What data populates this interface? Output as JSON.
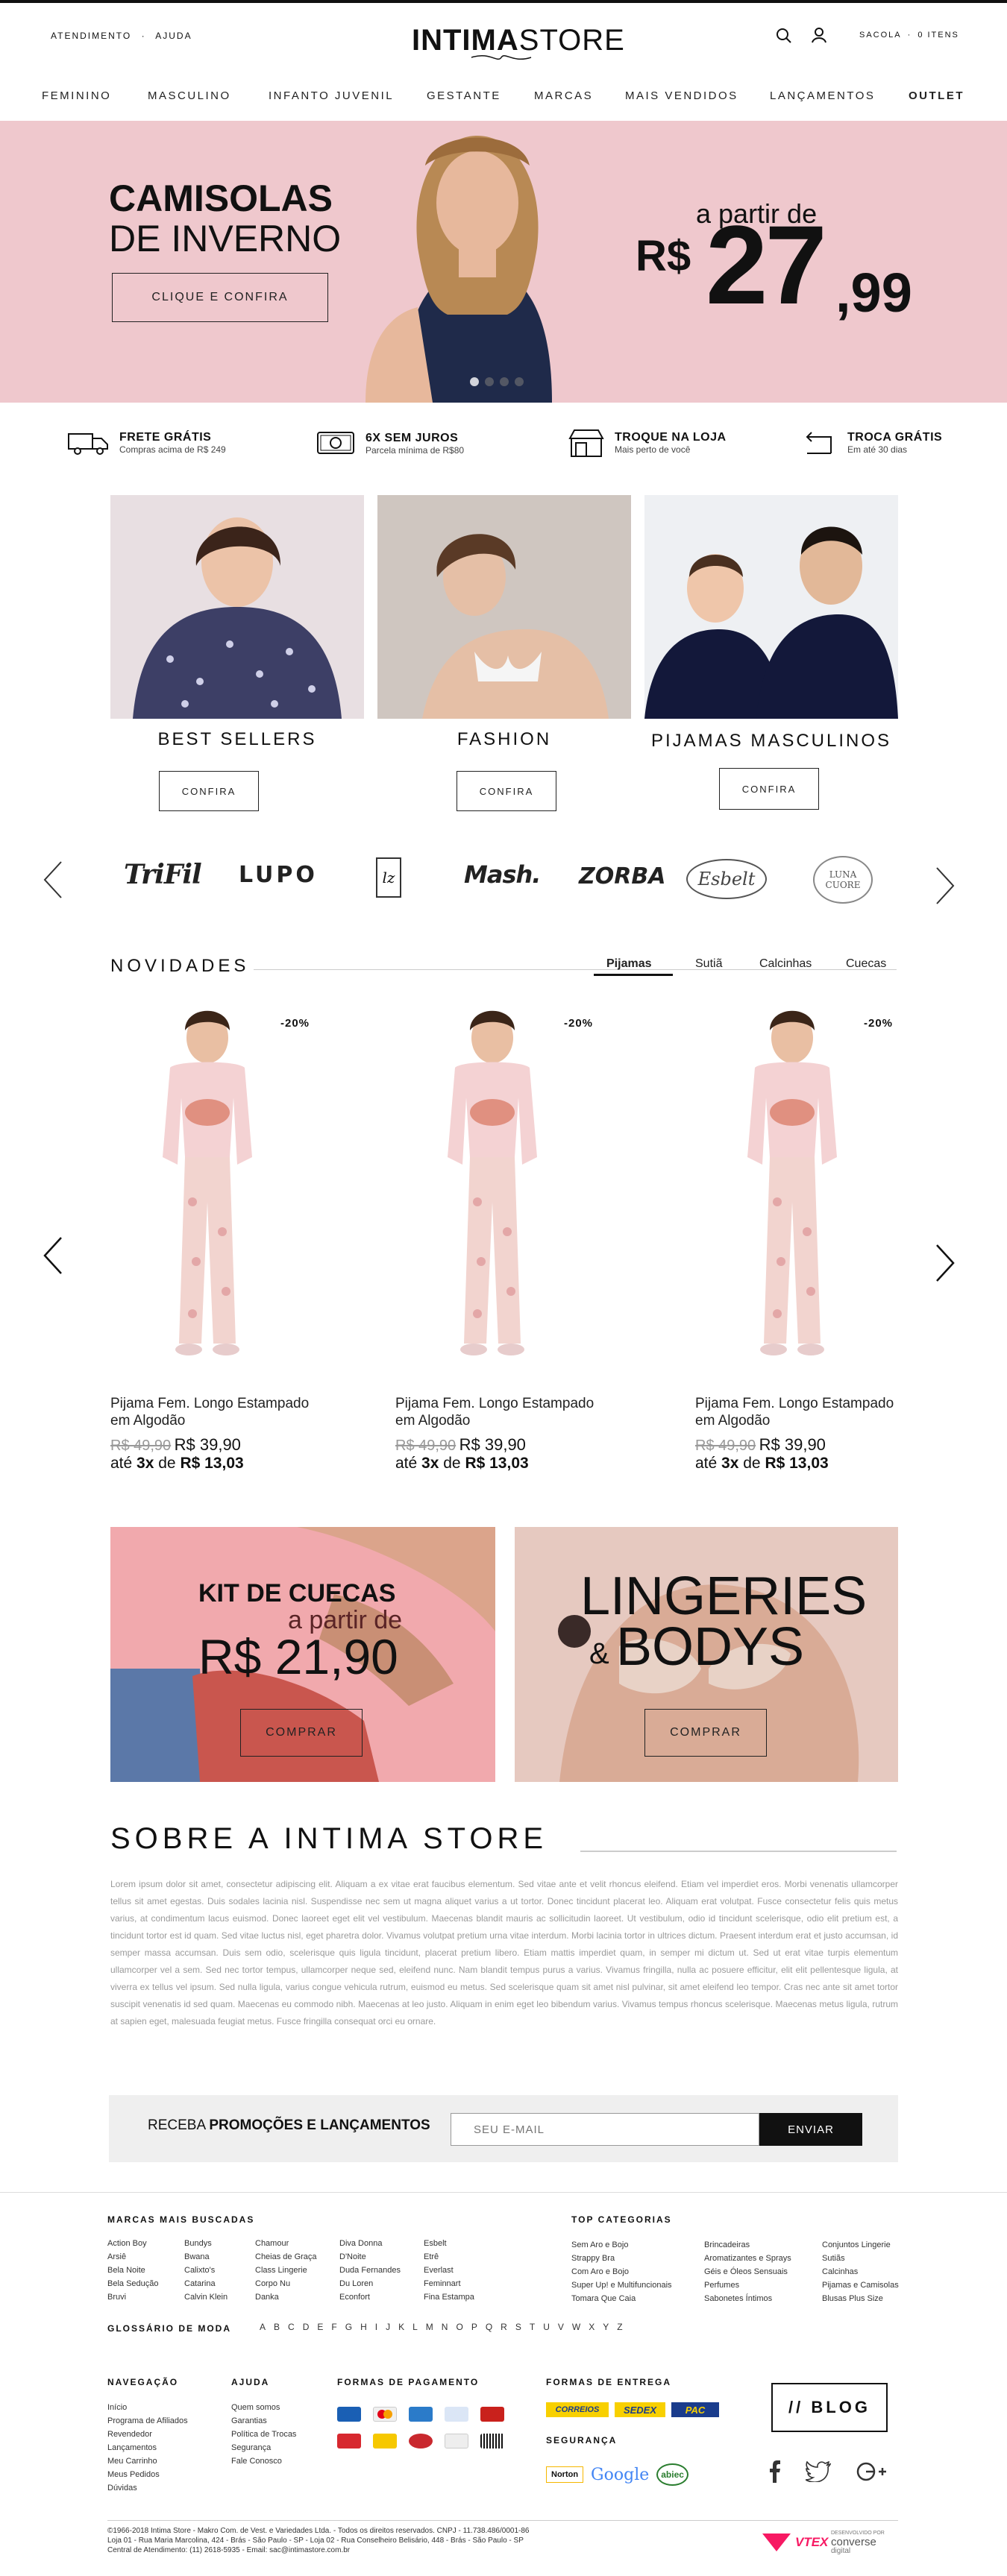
{
  "header": {
    "left_links": [
      "ATENDIMENTO",
      "AJUDA"
    ],
    "separator": "·",
    "logo_a": "INTIMA",
    "logo_b": "STORE",
    "bag_label": "SACOLA",
    "bag_sep": "·",
    "bag_count": "0 ITENS"
  },
  "nav": [
    "FEMININO",
    "MASCULINO",
    "INFANTO JUVENIL",
    "GESTANTE",
    "MARCAS",
    "MAIS VENDIDOS",
    "LANÇAMENTOS",
    "OUTLET"
  ],
  "hero": {
    "title_a": "CAMISOLAS",
    "title_b": "DE INVERNO",
    "cta": "CLIQUE E CONFIRA",
    "price_prefix": "a partir de",
    "currency": "R$",
    "price_int": "27",
    "price_dec": ",99",
    "dots": 4,
    "bg": "#efc8cd"
  },
  "features": [
    {
      "title": "FRETE GRÁTIS",
      "sub": "Compras acima de R$ 249",
      "icon": "truck-icon"
    },
    {
      "title": "6X SEM JUROS",
      "sub": "Parcela mínima de R$80",
      "icon": "money-icon"
    },
    {
      "title": "TROQUE NA LOJA",
      "sub": "Mais perto de você",
      "icon": "store-icon"
    },
    {
      "title": "TROCA GRÁTIS",
      "sub": "Em até 30 dias",
      "icon": "return-icon"
    }
  ],
  "categories": [
    {
      "title": "BEST SELLERS",
      "cta": "CONFIRA"
    },
    {
      "title": "FASHION",
      "cta": "CONFIRA"
    },
    {
      "title": "PIJAMAS MASCULINOS",
      "cta": "CONFIRA"
    }
  ],
  "brands": [
    "TriFil",
    "LUPO",
    "lz",
    "Mash.",
    "ZORBA",
    "Esbelt",
    "LUNA CUORE"
  ],
  "novidades": {
    "title": "NOVIDADES",
    "tabs": [
      "Pijamas",
      "Sutiã",
      "Calcinhas",
      "Cuecas"
    ],
    "active_tab": "Pijamas",
    "products": [
      {
        "discount": "-20%",
        "name": "Pijama Fem. Longo Estampado em Algodão",
        "old_price": "R$ 49,90",
        "new_price": "R$ 39,90",
        "inst_a": "até",
        "inst_n": "3x",
        "inst_b": "de",
        "inst_v": "R$ 13,03"
      },
      {
        "discount": "-20%",
        "name": "Pijama Fem. Longo Estampado em Algodão",
        "old_price": "R$ 49,90",
        "new_price": "R$ 39,90",
        "inst_a": "até",
        "inst_n": "3x",
        "inst_b": "de",
        "inst_v": "R$ 13,03"
      },
      {
        "discount": "-20%",
        "name": "Pijama Fem. Longo Estampado em Algodão",
        "old_price": "R$ 49,90",
        "new_price": "R$ 39,90",
        "inst_a": "até",
        "inst_n": "3x",
        "inst_b": "de",
        "inst_v": "R$ 13,03"
      }
    ]
  },
  "promo1": {
    "title": "KIT DE CUECAS",
    "sub": "a partir de",
    "price": "R$ 21,90",
    "cta": "COMPRAR"
  },
  "promo2": {
    "title_a": "LINGERIES",
    "amp": "&",
    "title_b": "BODYS",
    "cta": "COMPRAR"
  },
  "about": {
    "title": "SOBRE A INTIMA STORE",
    "text": "Lorem ipsum dolor sit amet, consectetur adipiscing elit. Aliquam a ex vitae erat faucibus elementum. Sed vitae ante et velit rhoncus eleifend. Etiam vel imperdiet eros. Morbi venenatis ullamcorper tellus sit amet egestas. Duis sodales lacinia nisl. Suspendisse nec sem ut magna aliquet varius a ut tortor. Donec tincidunt placerat leo. Aliquam erat volutpat. Fusce consectetur felis quis metus varius, at condimentum lacus euismod. Donec laoreet eget elit vel vestibulum. Maecenas blandit mauris ac sollicitudin laoreet. Ut vestibulum, odio id tincidunt scelerisque, odio elit pretium est, a tincidunt tortor est id quam. Sed vitae luctus nisl, eget pharetra dolor. Vivamus volutpat pretium urna vitae interdum. Morbi lacinia tortor in ultrices dictum. Praesent interdum erat et justo accumsan, id semper massa accumsan. Duis sem odio, scelerisque quis ligula tincidunt, placerat pretium libero. Etiam mattis imperdiet quam, in semper mi dictum ut. Sed ut erat vitae turpis elementum ullamcorper vel a sem. Sed nec tortor tempus, ullamcorper neque sed, eleifend nunc. Nam blandit tempus purus a varius. Vivamus fringilla, nulla ac posuere efficitur, elit elit pellentesque ligula, at viverra ex tellus vel ipsum. Sed nulla ligula, varius congue vehicula rutrum, euismod eu metus. Sed scelerisque quam sit amet nisl pulvinar, sit amet eleifend leo tempor. Cras nec ante sit amet tortor suscipit venenatis id sed quam. Maecenas eu commodo nibh. Maecenas at leo justo. Aliquam in enim eget leo bibendum varius. Vivamus tempus rhoncus scelerisque. Maecenas metus ligula, rutrum at sapien eget, malesuada feugiat metus. Fusce fringilla consequat orci eu ornare."
  },
  "newsletter": {
    "label_a": "RECEBA",
    "label_b": "PROMOÇÕES E LANÇAMENTOS",
    "placeholder": "SEU E-MAIL",
    "button": "ENVIAR"
  },
  "footer": {
    "brands_title": "MARCAS MAIS BUSCADAS",
    "brand_cols": [
      [
        "Action Boy",
        "Arsiê",
        "Bela Noite",
        "Bela Sedução",
        "Bruvi"
      ],
      [
        "Bundys",
        "Bwana",
        "Calixto's",
        "Catarina",
        "Calvin Klein"
      ],
      [
        "Chamour",
        "Cheias de Graça",
        "Class Lingerie",
        "Corpo Nu",
        "Danka"
      ],
      [
        "Diva Donna",
        "D'Noite",
        "Duda Fernandes",
        "Du Loren",
        "Econfort"
      ],
      [
        "Esbelt",
        "Etrê",
        "Everlast",
        "Feminnart",
        "Fina Estampa"
      ]
    ],
    "cats_title": "TOP CATEGORIAS",
    "cat_cols": [
      [
        "Sem Aro e Bojo",
        "Strappy Bra",
        "Com Aro e Bojo",
        "Super Up! e Multifuncionais",
        "Tomara Que Caia"
      ],
      [
        "Brincadeiras",
        "Aromatizantes e Sprays",
        "Géis e Óleos Sensuais",
        "Perfumes",
        "Sabonetes Íntimos"
      ],
      [
        "Conjuntos Lingerie",
        "Sutiãs",
        "Calcinhas",
        "Pijamas e Camisolas",
        "Blusas Plus Size"
      ]
    ],
    "glossary_title": "GLOSSÁRIO DE MODA",
    "letters": [
      "A",
      "B",
      "C",
      "D",
      "E",
      "F",
      "G",
      "H",
      "I",
      "J",
      "K",
      "L",
      "M",
      "N",
      "O",
      "P",
      "Q",
      "R",
      "S",
      "T",
      "U",
      "V",
      "W",
      "X",
      "Y",
      "Z"
    ],
    "nav_title": "NAVEGAÇÃO",
    "nav_links": [
      "Início",
      "Programa de Afiliados",
      "Revendedor",
      "Lançamentos",
      "Meu Carrinho",
      "Meus Pedidos",
      "Dúvidas"
    ],
    "help_title": "AJUDA",
    "help_links": [
      "Quem somos",
      "Garantias",
      "Política de Trocas",
      "Segurança",
      "Fale Conosco"
    ],
    "pay_title": "FORMAS DE PAGAMENTO",
    "ship_title": "FORMAS DE ENTREGA",
    "ship": [
      "CORREIOS",
      "SEDEX",
      "PAC"
    ],
    "sec_title": "SEGURANÇA",
    "sec": [
      "Norton",
      "Google",
      "abiec"
    ],
    "blog": "// BLOG",
    "copyright": [
      "©1966-2018 Intima Store - Makro Com. de Vest. e Variedades Ltda. - Todos os direitos reservados. CNPJ - 11.738.486/0001-86",
      "Loja 01 - Rua Maria Marcolina, 424 - Brás - São Paulo - SP - Loja 02 - Rua Conselheiro Belisário, 448 - Brás - São Paulo - SP",
      "Central de Atendimento: (11) 2618-5935 - Email: sac@intimastore.com.br"
    ],
    "vtex": "VTEX",
    "agency_a": "DESENVOLVIDO POR",
    "agency_b": "converse",
    "agency_c": "digital"
  }
}
